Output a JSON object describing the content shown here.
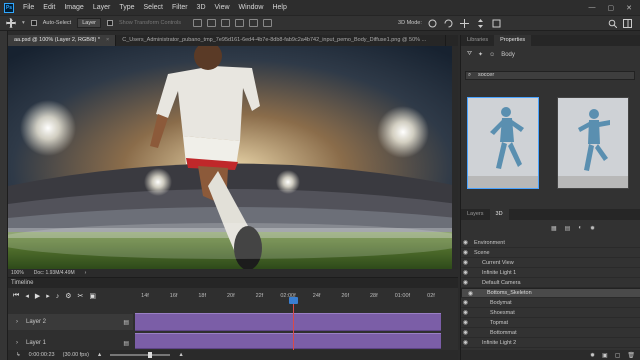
{
  "app": {
    "logo_text": "Ps"
  },
  "menu": {
    "items": [
      "File",
      "Edit",
      "Image",
      "Layer",
      "Type",
      "Select",
      "Filter",
      "3D",
      "View",
      "Window",
      "Help"
    ]
  },
  "window_controls": {
    "minimize": "—",
    "maximize": "▢",
    "close": "✕"
  },
  "options_bar": {
    "auto_select_label": "Auto-Select",
    "auto_select_target": "Layer",
    "show_transform_label": "Show Transform Controls",
    "mode_label": "3D Mode:"
  },
  "document_tabs": [
    {
      "label": "aa.psd @ 100% (Layer 2, RGB/8) *",
      "active": true
    },
    {
      "label": "C_Users_Administrator_pubano_tmp_7e95d161-6ed4-4b7e-8db8-fab9c2a4b742_input_pemo_Body_Diffuse1.png @ 50% ...",
      "active": false
    }
  ],
  "status": {
    "zoom": "100%",
    "doc": "Doc: 1.93M/4.49M"
  },
  "timeline": {
    "title": "Timeline",
    "ruler_ticks": [
      "14f",
      "16f",
      "18f",
      "20f",
      "22f",
      "02:00f",
      "24f",
      "26f",
      "28f",
      "01:00f",
      "02f"
    ],
    "layers": [
      {
        "name": "Layer 2"
      },
      {
        "name": "Layer 1"
      }
    ],
    "current_time": "0:00:00:23",
    "fps": "(30.00 fps)"
  },
  "right_panel": {
    "tabs": [
      "Libraries",
      "Properties"
    ],
    "active_tab": "Properties",
    "property_type": "Body",
    "search_value": "soccer",
    "layer_tabs": [
      "Layers",
      "3D"
    ],
    "scene_items": [
      {
        "name": "Environment",
        "indent": 0
      },
      {
        "name": "Scene",
        "indent": 0
      },
      {
        "name": "Current View",
        "indent": 1
      },
      {
        "name": "Infinite Light 1",
        "indent": 1
      },
      {
        "name": "Default Camera",
        "indent": 1
      },
      {
        "name": "Bottoms_Skeleton",
        "indent": 1,
        "selected": true
      },
      {
        "name": "Bodymat",
        "indent": 2
      },
      {
        "name": "Shoesmat",
        "indent": 2
      },
      {
        "name": "Topmat",
        "indent": 2
      },
      {
        "name": "Bottommat",
        "indent": 2
      },
      {
        "name": "Infinite Light 2",
        "indent": 1
      }
    ]
  },
  "colors": {
    "accent": "#31a8ff",
    "clip": "#7b5ea7",
    "playhead": "#d94a4a"
  }
}
